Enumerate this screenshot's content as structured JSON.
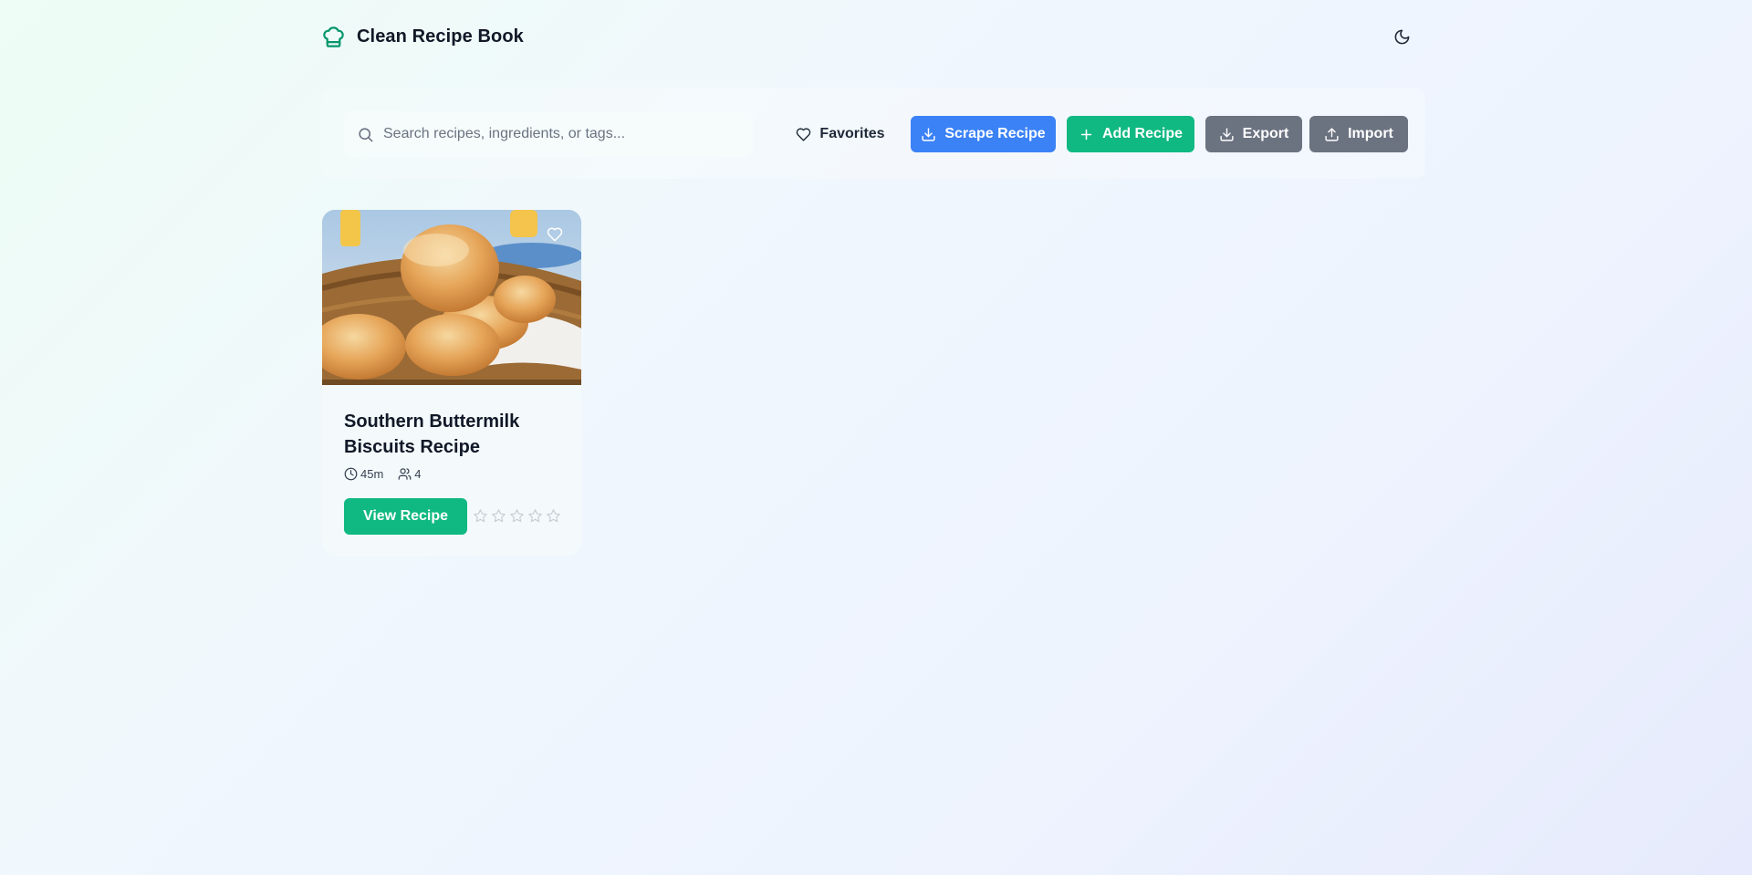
{
  "header": {
    "title": "Clean Recipe Book",
    "logo_icon": "chef-hat-icon",
    "theme_toggle_icon": "moon-icon"
  },
  "toolbar": {
    "search": {
      "placeholder": "Search recipes, ingredients, or tags...",
      "value": ""
    },
    "favorites_label": "Favorites",
    "scrape_label": "Scrape Recipe",
    "add_label": "Add Recipe",
    "export_label": "Export",
    "import_label": "Import"
  },
  "colors": {
    "accent_green": "#10b981",
    "accent_blue": "#3b82f6",
    "neutral_gray": "#6b7280",
    "brand_icon": "#059669"
  },
  "recipes": [
    {
      "title": "Southern Buttermilk Biscuits Recipe",
      "time": "45m",
      "servings": "4",
      "view_label": "View Recipe",
      "rating": 0,
      "rating_max": 5,
      "favorite": false
    }
  ]
}
